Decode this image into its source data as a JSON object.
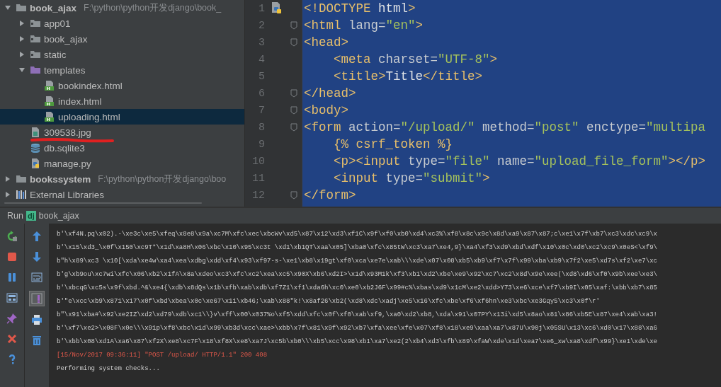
{
  "project_tree": [
    {
      "kind": "project",
      "name": "book_ajax",
      "path": "F:\\python\\python开发django\\book_",
      "expanded": true,
      "selected": false,
      "children": [
        {
          "kind": "folder",
          "name": "app01",
          "expanded": false,
          "selected": false
        },
        {
          "kind": "folder",
          "name": "book_ajax",
          "expanded": false,
          "selected": false
        },
        {
          "kind": "folder",
          "name": "static",
          "expanded": false,
          "selected": false
        },
        {
          "kind": "template-folder",
          "name": "templates",
          "expanded": true,
          "selected": false,
          "children": [
            {
              "kind": "html",
              "name": "bookindex.html",
              "selected": false
            },
            {
              "kind": "html",
              "name": "index.html",
              "selected": false
            },
            {
              "kind": "html",
              "name": "uploading.html",
              "selected": true
            }
          ]
        },
        {
          "kind": "image",
          "name": "309538.jpg",
          "selected": false,
          "underlined": true
        },
        {
          "kind": "database",
          "name": "db.sqlite3",
          "selected": false
        },
        {
          "kind": "python",
          "name": "manage.py",
          "selected": false
        }
      ]
    },
    {
      "kind": "project",
      "name": "bookssystem",
      "path": "F:\\python\\python开发django\\boo",
      "expanded": false,
      "selected": false
    },
    {
      "kind": "library",
      "name": "External Libraries",
      "expanded": false,
      "selected": false
    }
  ],
  "editor": {
    "lines": [
      {
        "number": "1",
        "fold": false,
        "indented": false,
        "tokens": [
          {
            "kind": "tag",
            "text": "<!DOCTYPE"
          },
          {
            "kind": "plain",
            "text": " html"
          },
          {
            "kind": "tag",
            "text": ">"
          }
        ]
      },
      {
        "number": "2",
        "fold": true,
        "indented": false,
        "tokens": [
          {
            "kind": "tag",
            "text": "<html"
          },
          {
            "kind": "attr",
            "text": " lang="
          },
          {
            "kind": "string",
            "text": "\"en\""
          },
          {
            "kind": "tag",
            "text": ">"
          }
        ]
      },
      {
        "number": "3",
        "fold": true,
        "indented": false,
        "tokens": [
          {
            "kind": "tag",
            "text": "<head>"
          }
        ]
      },
      {
        "number": "4",
        "fold": false,
        "indented": true,
        "tokens": [
          {
            "kind": "tag",
            "text": "<meta"
          },
          {
            "kind": "attr",
            "text": " charset="
          },
          {
            "kind": "string",
            "text": "\"UTF-8\""
          },
          {
            "kind": "tag",
            "text": ">"
          }
        ]
      },
      {
        "number": "5",
        "fold": false,
        "indented": true,
        "tokens": [
          {
            "kind": "tag",
            "text": "<title>"
          },
          {
            "kind": "plain",
            "text": "Title"
          },
          {
            "kind": "tag",
            "text": "</title>"
          }
        ]
      },
      {
        "number": "6",
        "fold": true,
        "indented": false,
        "tokens": [
          {
            "kind": "tag",
            "text": "</head>"
          }
        ]
      },
      {
        "number": "7",
        "fold": true,
        "indented": false,
        "tokens": [
          {
            "kind": "tag",
            "text": "<body>"
          }
        ]
      },
      {
        "number": "8",
        "fold": true,
        "indented": false,
        "tokens": [
          {
            "kind": "tag",
            "text": "<form"
          },
          {
            "kind": "attr",
            "text": " action="
          },
          {
            "kind": "string",
            "text": "\"/upload/\""
          },
          {
            "kind": "attr",
            "text": " method="
          },
          {
            "kind": "string",
            "text": "\"post\""
          },
          {
            "kind": "attr",
            "text": " enctype="
          },
          {
            "kind": "string",
            "text": "\"multipa"
          }
        ]
      },
      {
        "number": "9",
        "fold": false,
        "indented": true,
        "tokens": [
          {
            "kind": "tag",
            "text": "{% csrf_token %}"
          }
        ]
      },
      {
        "number": "10",
        "fold": false,
        "indented": true,
        "tokens": [
          {
            "kind": "tag",
            "text": "<p><input"
          },
          {
            "kind": "attr",
            "text": " type="
          },
          {
            "kind": "string",
            "text": "\"file\""
          },
          {
            "kind": "attr",
            "text": " name="
          },
          {
            "kind": "string",
            "text": "\"upload_file_form\""
          },
          {
            "kind": "tag",
            "text": "></p>"
          }
        ]
      },
      {
        "number": "11",
        "fold": false,
        "indented": true,
        "tokens": [
          {
            "kind": "tag",
            "text": "<input"
          },
          {
            "kind": "attr",
            "text": " type="
          },
          {
            "kind": "string",
            "text": "\"submit\""
          },
          {
            "kind": "tag",
            "text": ">"
          }
        ]
      },
      {
        "number": "12",
        "fold": true,
        "indented": false,
        "tokens": [
          {
            "kind": "tag",
            "text": "</form>"
          }
        ]
      }
    ]
  },
  "run_panel": {
    "label": "Run",
    "badge": "dj",
    "config": "book_ajax",
    "column_1": [
      {
        "kind": "rerun"
      },
      {
        "kind": "stop"
      },
      {
        "kind": "pause"
      },
      {
        "kind": "layout"
      },
      {
        "kind": "pin"
      },
      {
        "kind": "close"
      },
      {
        "kind": "help"
      }
    ],
    "column_2": [
      {
        "kind": "up",
        "selected": false
      },
      {
        "kind": "down",
        "selected": false
      },
      {
        "kind": "wrap",
        "selected": false
      },
      {
        "kind": "scroll-end",
        "selected": true
      },
      {
        "kind": "print",
        "selected": false
      },
      {
        "kind": "trash",
        "selected": false
      }
    ],
    "console": [
      {
        "kind": "output",
        "text": "b'\\xf4N.pq\\x02).-\\xe3c\\xe5\\xfeq\\x8e8\\x9a\\xc7M\\xfc\\xec\\xbcWv\\xd5\\x87\\x12\\xd3\\xf1C\\x9f\\xf0\\xb0\\xd4\\xc3%\\xf8\\x8c\\x9c\\x8d\\xa9\\x87\\x87;c\\xe1\\x7f\\xb7\\xc3\\xdc\\xc9\\x"
      },
      {
        "kind": "output",
        "text": "b'\\x15\\xd3_\\x0f\\x150\\xc9T*\\x1d\\xa8H\\x06\\xbc\\x10\\x95\\xc3t \\xd1\\xb1QT\\xaa\\x05]\\xba0\\xfc\\x85tW\\xc3\\xa7\\xe4,9}\\xa4\\xf3\\xd9\\xbd\\xdf\\x10\\x0c\\xd0\\xc2\\xc9\\x0eS<\\xf9\\"
      },
      {
        "kind": "output",
        "text": "b\"h\\x89\\xc3 \\x10[\\xda\\xe4w\\xa4\\xea\\xdbg\\xdd\\xf4\\x93\\xf97-s-\\xe1\\xb8\\x19gt\\xf0\\xca\\xe7e\\xab\\\\\\xde\\x07\\x08\\xb5\\xb9\\xf7\\x7f\\x99\\xba\\xb9\\x7f2\\xe5\\xd7s\\xf2\\xe7\\xc"
      },
      {
        "kind": "output",
        "text": "b'g\\xb9ou\\xc7wi\\xfc\\x06\\xb2\\x1fA\\x8a\\xdeo\\xc3\\xfc\\xc2\\xea\\xc5\\x90X\\xb6\\xd2I>\\x1d\\x93M1k\\xf3\\xb1\\xd2\\xbe\\xe9\\x92\\xc7\\xc2\\x8d\\x9e\\xee(\\xd8\\xd6\\xf0\\x9b\\xee\\xe3\\"
      },
      {
        "kind": "output",
        "text": "b'\\xbcqG\\xc5s\\x9f\\xbd.^&\\xe4{\\xdb\\x8dQs\\x1b\\xfb\\xab\\xdb\\xf7Z1\\xf1\\xda6h\\xc0\\xe0\\xb2J6F\\x99#c%\\xbas\\xd9\\x1cM\\xe2\\xdd>Y73\\xe6\\xce\\xf7\\xb9I\\x05\\xaf:\\xbb\\xb7\\x85"
      },
      {
        "kind": "output",
        "text": "b'\"e\\xcc\\xb9\\x871\\x17\\x0f\\xbd\\xbea\\x0c\\xe67\\x11\\xb46;\\xab\\x88\"k!\\x8af26\\xb2(\\xd8\\xdc\\xadj\\xe5\\x16\\xfc\\xbe\\xf6\\xf6hn\\xe3\\xbc\\xe3Gqy5\\xc3\\x0f\\r'"
      },
      {
        "kind": "output",
        "text": "b\"\\x91\\xba#\\x92\\xe2IZ\\xd2\\xd79\\xdb\\xc1\\\\}v\\xff\\x00\\x037%o\\xf5\\xdd\\xfc\\x0f\\xf0\\xab\\xf9,\\xa0\\xd2\\xb8,\\xda\\x91\\x07PY\\x13i\\xd5\\x8ao\\x81\\x86\\xb5E\\x87\\xe4\\xab\\xa3!"
      },
      {
        "kind": "output",
        "text": "b'\\xf7\\xe2>\\x08F\\x0e\\\\\\x91p\\xf8\\xbc\\x1d\\x99\\xb3d\\xcc\\xae>\\xbb\\x7f\\x81\\x9f\\x92\\xb7\\xfa\\xee\\xfe\\x07\\xf8\\x18\\xe9\\xaa\\xa7\\x87U\\x90j\\x05SU\\x13\\xc6\\xd0\\x17\\x88\\xa6"
      },
      {
        "kind": "output",
        "text": "b'\\xbb\\x08\\xd1A\\xa6\\x87\\xf2X\\xe8\\xc7F\\x18\\xf8X\\xe8\\xa7J\\xc5b\\xb0\\\\\\xb5\\xcc\\x98\\xb1\\xa7\\xe2(2\\xb4\\xd3\\xfb\\x89\\xfaW\\xde\\x1d\\xea7\\xe6_xw\\xa8\\xdf\\x99}\\xe1\\xde\\xe"
      },
      {
        "kind": "error",
        "text": "[15/Nov/2017 09:36:11] \"POST /upload/ HTTP/1.1\" 200 408"
      },
      {
        "kind": "output",
        "text": "Performing system checks..."
      }
    ]
  }
}
